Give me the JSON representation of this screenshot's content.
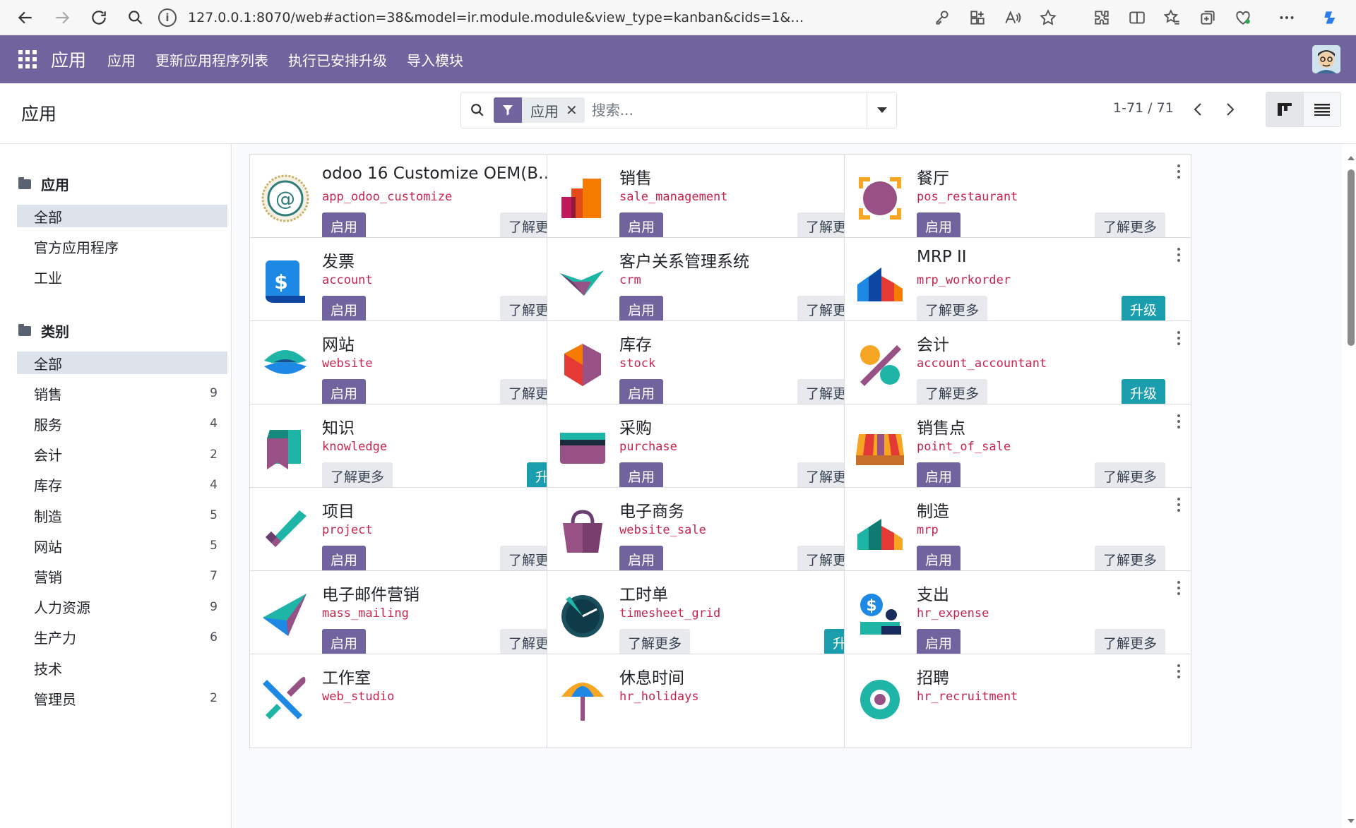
{
  "browser": {
    "url": "127.0.0.1:8070/web#action=38&model=ir.module.module&view_type=kanban&cids=1&me..."
  },
  "navbar": {
    "brand": "应用",
    "items": [
      "应用",
      "更新应用程序列表",
      "执行已安排升级",
      "导入模块"
    ]
  },
  "control": {
    "breadcrumb": "应用",
    "facet": "应用",
    "search_placeholder": "搜索...",
    "pager": "1-71 / 71"
  },
  "sidebar": {
    "apps_header": "应用",
    "apps_items": [
      {
        "label": "全部",
        "active": true
      },
      {
        "label": "官方应用程序",
        "active": false
      },
      {
        "label": "工业",
        "active": false
      }
    ],
    "cat_header": "类别",
    "cat_items": [
      {
        "label": "全部",
        "count": "",
        "active": true
      },
      {
        "label": "销售",
        "count": "9"
      },
      {
        "label": "服务",
        "count": "4"
      },
      {
        "label": "会计",
        "count": "2"
      },
      {
        "label": "库存",
        "count": "4"
      },
      {
        "label": "制造",
        "count": "5"
      },
      {
        "label": "网站",
        "count": "5"
      },
      {
        "label": "营销",
        "count": "7"
      },
      {
        "label": "人力资源",
        "count": "9"
      },
      {
        "label": "生产力",
        "count": "6"
      },
      {
        "label": "技术",
        "count": ""
      },
      {
        "label": "管理员",
        "count": "2"
      }
    ]
  },
  "buttons": {
    "install": "启用",
    "learn_more": "了解更多",
    "upgrade": "升级"
  },
  "apps": [
    {
      "name": "odoo 16 Customize OEM(Bo...",
      "tech": "app_odoo_customize",
      "state": "install",
      "icon": "customize-icon"
    },
    {
      "name": "销售",
      "tech": "sale_management",
      "state": "install",
      "icon": "sales-icon"
    },
    {
      "name": "餐厅",
      "tech": "pos_restaurant",
      "state": "install",
      "icon": "restaurant-icon"
    },
    {
      "name": "发票",
      "tech": "account",
      "state": "install",
      "icon": "invoice-icon"
    },
    {
      "name": "客户关系管理系统",
      "tech": "crm",
      "state": "install",
      "icon": "crm-icon"
    },
    {
      "name": "MRP II",
      "tech": "mrp_workorder",
      "state": "upgrade",
      "icon": "mrp-icon"
    },
    {
      "name": "网站",
      "tech": "website",
      "state": "install",
      "icon": "website-icon"
    },
    {
      "name": "库存",
      "tech": "stock",
      "state": "install",
      "icon": "inventory-icon"
    },
    {
      "name": "会计",
      "tech": "account_accountant",
      "state": "upgrade",
      "icon": "accounting-icon"
    },
    {
      "name": "知识",
      "tech": "knowledge",
      "state": "upgrade",
      "icon": "knowledge-icon"
    },
    {
      "name": "采购",
      "tech": "purchase",
      "state": "install",
      "icon": "purchase-icon"
    },
    {
      "name": "销售点",
      "tech": "point_of_sale",
      "state": "install",
      "icon": "pos-icon"
    },
    {
      "name": "项目",
      "tech": "project",
      "state": "install",
      "icon": "project-icon"
    },
    {
      "name": "电子商务",
      "tech": "website_sale",
      "state": "install",
      "icon": "ecommerce-icon"
    },
    {
      "name": "制造",
      "tech": "mrp",
      "state": "install",
      "icon": "manufacturing-icon"
    },
    {
      "name": "电子邮件营销",
      "tech": "mass_mailing",
      "state": "install",
      "icon": "email-marketing-icon"
    },
    {
      "name": "工时单",
      "tech": "timesheet_grid",
      "state": "upgrade",
      "icon": "timesheet-icon"
    },
    {
      "name": "支出",
      "tech": "hr_expense",
      "state": "install",
      "icon": "expense-icon"
    },
    {
      "name": "工作室",
      "tech": "web_studio",
      "state": "partial",
      "icon": "studio-icon"
    },
    {
      "name": "休息时间",
      "tech": "hr_holidays",
      "state": "partial",
      "icon": "time-off-icon"
    },
    {
      "name": "招聘",
      "tech": "hr_recruitment",
      "state": "partial",
      "icon": "recruitment-icon"
    }
  ]
}
